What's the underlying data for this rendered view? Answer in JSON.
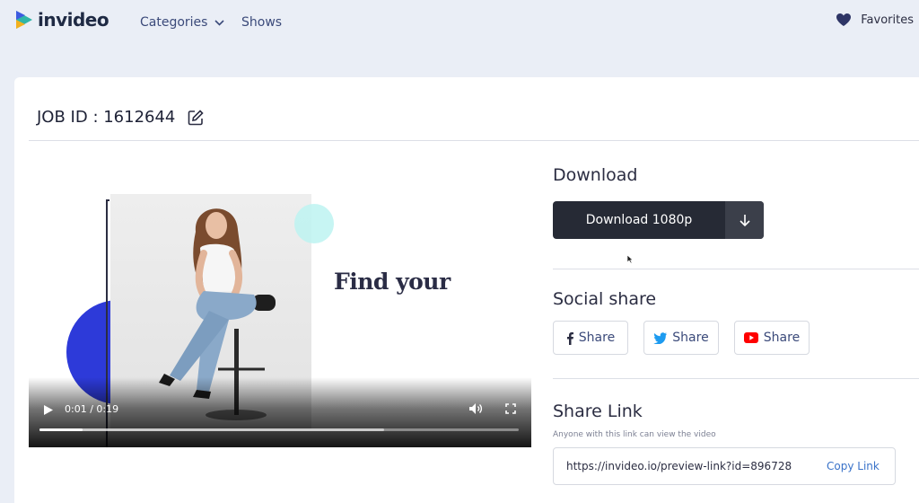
{
  "nav": {
    "logo_text": "invideo",
    "categories_label": "Categories",
    "shows_label": "Shows",
    "favorites_label": "Favorites"
  },
  "job": {
    "title": "JOB ID : 1612644"
  },
  "video": {
    "overlay_text": "Find your",
    "time": "0:01 / 0:19",
    "played_fraction": 0.09,
    "buffered_fraction": 0.72
  },
  "download": {
    "title": "Download",
    "button_label": "Download 1080p"
  },
  "social": {
    "title": "Social share",
    "facebook_label": "Share",
    "twitter_label": "Share",
    "youtube_label": "Share"
  },
  "share_link": {
    "title": "Share Link",
    "hint": "Anyone with this link can view the video",
    "url": "https://invideo.io/preview-link?id=896728",
    "copy_label": "Copy Link"
  },
  "colors": {
    "page_bg": "#eaeef6",
    "dark_button": "#262a35",
    "link_blue": "#3a73c9",
    "facebook": "#1877f2",
    "twitter": "#1d9bf0",
    "youtube": "#ff0000"
  }
}
